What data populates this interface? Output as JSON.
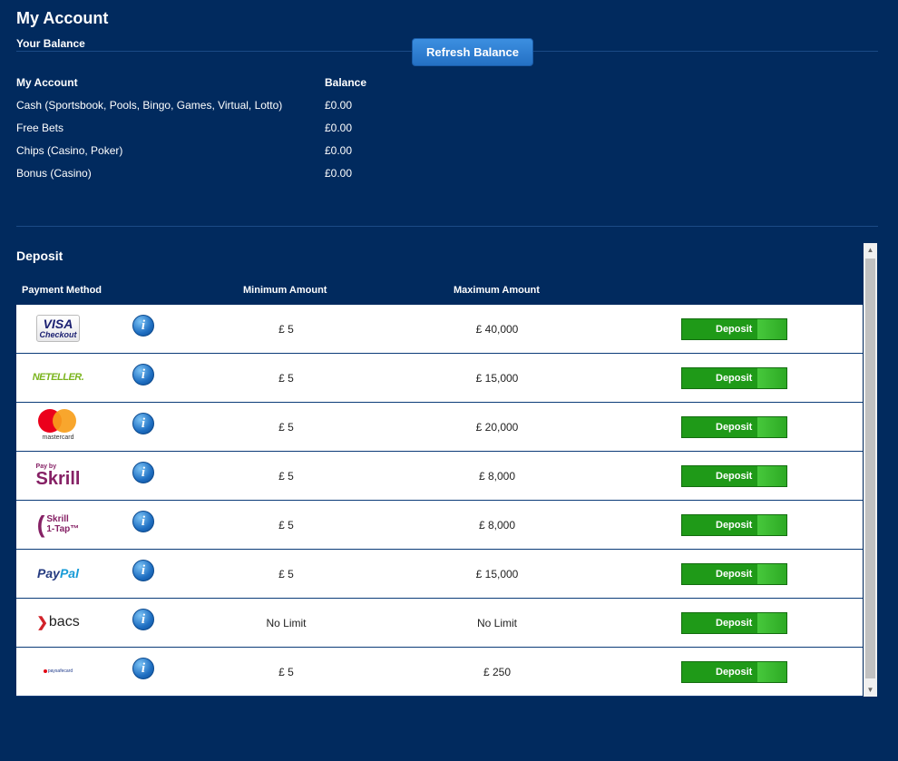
{
  "header": {
    "title": "My Account",
    "balance_section": "Your Balance",
    "refresh_label": "Refresh Balance"
  },
  "balance": {
    "col_account": "My Account",
    "col_balance": "Balance",
    "rows": [
      {
        "label": "Cash (Sportsbook, Pools, Bingo, Games, Virtual, Lotto)",
        "value": "£0.00"
      },
      {
        "label": "Free Bets",
        "value": "£0.00"
      },
      {
        "label": "Chips (Casino, Poker)",
        "value": "£0.00"
      },
      {
        "label": "Bonus (Casino)",
        "value": "£0.00"
      }
    ]
  },
  "deposit": {
    "title": "Deposit",
    "col_method": "Payment Method",
    "col_min": "Minimum Amount",
    "col_max": "Maximum Amount",
    "button_label": "Deposit",
    "info_glyph": "i",
    "methods": [
      {
        "logo": "visa-checkout",
        "logo_text": [
          "VISA",
          "Checkout"
        ],
        "min": "£ 5",
        "max": "£ 40,000"
      },
      {
        "logo": "neteller",
        "logo_text": [
          "NETELLER."
        ],
        "min": "£ 5",
        "max": "£ 15,000"
      },
      {
        "logo": "mastercard",
        "logo_text": [
          "mastercard"
        ],
        "min": "£ 5",
        "max": "£ 20,000"
      },
      {
        "logo": "skrill",
        "logo_text": [
          "Pay by",
          "Skrill"
        ],
        "min": "£ 5",
        "max": "£ 8,000"
      },
      {
        "logo": "skrill-1-tap",
        "logo_text": [
          "Skrill",
          "1-Tap™"
        ],
        "min": "£ 5",
        "max": "£ 8,000"
      },
      {
        "logo": "paypal",
        "logo_text": [
          "Pay",
          "Pal"
        ],
        "min": "£ 5",
        "max": "£ 15,000"
      },
      {
        "logo": "bacs",
        "logo_text": [
          "bacs"
        ],
        "min": "No Limit",
        "max": "No Limit"
      },
      {
        "logo": "paysafecard",
        "logo_text": [
          "paysafecard"
        ],
        "min": "£ 5",
        "max": "£ 250"
      }
    ]
  },
  "colors": {
    "background": "#012a5e",
    "refresh_button": "#2470c4",
    "deposit_button": "#1f9a18"
  },
  "icons": {
    "info": "info-icon",
    "scroll_up": "▲",
    "scroll_down": "▼"
  }
}
